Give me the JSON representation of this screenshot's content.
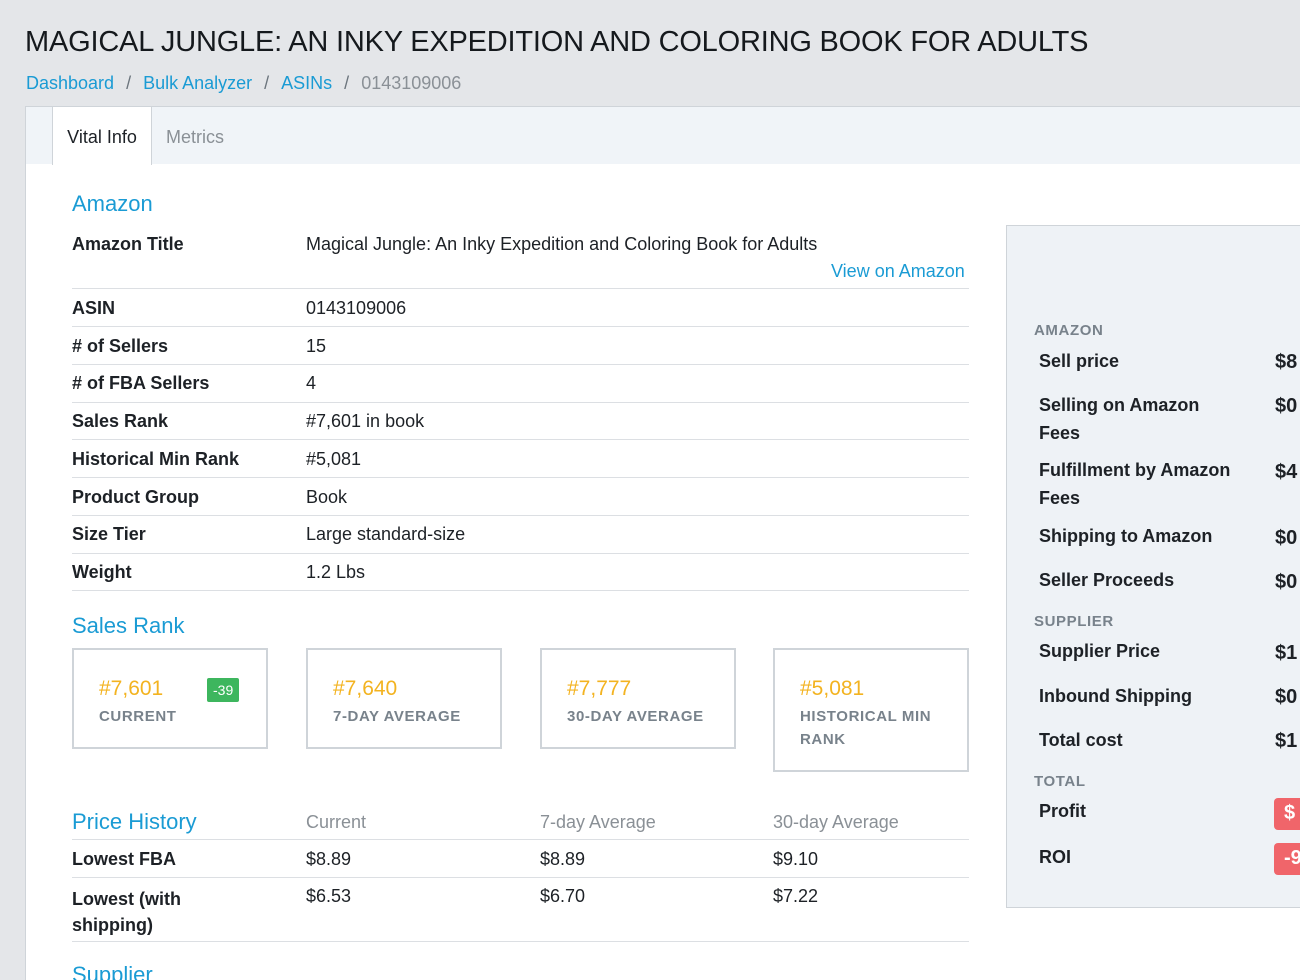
{
  "header": {
    "title": "MAGICAL JUNGLE: AN INKY EXPEDITION AND COLORING BOOK FOR ADULTS",
    "breadcrumb": [
      "Dashboard",
      "Bulk Analyzer",
      "ASINs",
      "0143109006"
    ],
    "breadcrumb_separator": "/"
  },
  "tabs": [
    {
      "label": "Vital Info",
      "active": true
    },
    {
      "label": "Metrics",
      "active": false
    }
  ],
  "amazon": {
    "heading": "Amazon",
    "title_label": "Amazon Title",
    "title_value": "Magical Jungle: An Inky Expedition and Coloring Book for Adults",
    "view_link": "View on Amazon",
    "rows": [
      {
        "label": "ASIN",
        "value": "0143109006"
      },
      {
        "label": "# of Sellers",
        "value": "15"
      },
      {
        "label": "# of FBA Sellers",
        "value": "4"
      },
      {
        "label": "Sales Rank",
        "value": "#7,601 in book"
      },
      {
        "label": "Historical Min Rank",
        "value": "#5,081"
      },
      {
        "label": "Product Group",
        "value": "Book"
      },
      {
        "label": "Size Tier",
        "value": "Large standard-size"
      },
      {
        "label": "Weight",
        "value": "1.2 Lbs"
      }
    ]
  },
  "sales_rank": {
    "heading": "Sales Rank",
    "boxes": [
      {
        "value": "#7,601",
        "label": "CURRENT",
        "badge": "-39"
      },
      {
        "value": "#7,640",
        "label": "7-DAY AVERAGE"
      },
      {
        "value": "#7,777",
        "label": "30-DAY AVERAGE"
      },
      {
        "value": "#5,081",
        "label": "HISTORICAL MIN RANK"
      }
    ]
  },
  "price_history": {
    "heading": "Price History",
    "columns": [
      "Current",
      "7-day Average",
      "30-day Average"
    ],
    "rows": [
      {
        "label": "Lowest FBA",
        "values": [
          "$8.89",
          "$8.89",
          "$9.10"
        ]
      },
      {
        "label": "Lowest (with shipping)",
        "values": [
          "$6.53",
          "$6.70",
          "$7.22"
        ]
      }
    ]
  },
  "supplier": {
    "heading": "Supplier"
  },
  "sidebar": {
    "amazon_head": "AMAZON",
    "amazon_rows": [
      {
        "label": "Sell price",
        "value": "$8"
      },
      {
        "label": "Selling on Amazon Fees",
        "value": "$0"
      },
      {
        "label": "Fulfillment by Amazon Fees",
        "value": "$4"
      },
      {
        "label": "Shipping to Amazon",
        "value": "$0"
      },
      {
        "label": "Seller Proceeds",
        "value": "$0"
      }
    ],
    "supplier_head": "SUPPLIER",
    "supplier_rows": [
      {
        "label": "Supplier Price",
        "value": "$1"
      },
      {
        "label": "Inbound Shipping",
        "value": "$0"
      },
      {
        "label": "Total cost",
        "value": "$1"
      }
    ],
    "total_head": "TOTAL",
    "total_rows": [
      {
        "label": "Profit",
        "value": "$"
      },
      {
        "label": "ROI",
        "value": "-9"
      }
    ]
  },
  "colors": {
    "accent": "#1a9bd4",
    "rank": "#f3b320",
    "positive": "#3db65e",
    "negative": "#f0656a"
  }
}
